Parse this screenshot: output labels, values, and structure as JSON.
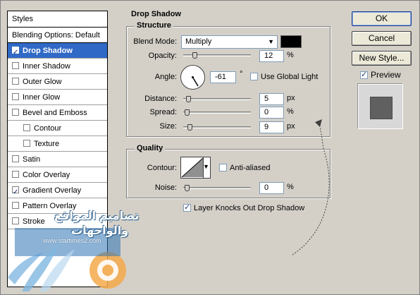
{
  "styles_panel": {
    "header": "Styles",
    "items": [
      {
        "label": "Blending Options: Default",
        "has_checkbox": false,
        "checked": false,
        "selected": false,
        "sub": false
      },
      {
        "label": "Drop Shadow",
        "has_checkbox": true,
        "checked": true,
        "selected": true,
        "sub": false
      },
      {
        "label": "Inner Shadow",
        "has_checkbox": true,
        "checked": false,
        "selected": false,
        "sub": false
      },
      {
        "label": "Outer Glow",
        "has_checkbox": true,
        "checked": false,
        "selected": false,
        "sub": false
      },
      {
        "label": "Inner Glow",
        "has_checkbox": true,
        "checked": false,
        "selected": false,
        "sub": false
      },
      {
        "label": "Bevel and Emboss",
        "has_checkbox": true,
        "checked": false,
        "selected": false,
        "sub": false
      },
      {
        "label": "Contour",
        "has_checkbox": true,
        "checked": false,
        "selected": false,
        "sub": true
      },
      {
        "label": "Texture",
        "has_checkbox": true,
        "checked": false,
        "selected": false,
        "sub": true
      },
      {
        "label": "Satin",
        "has_checkbox": true,
        "checked": false,
        "selected": false,
        "sub": false
      },
      {
        "label": "Color Overlay",
        "has_checkbox": true,
        "checked": false,
        "selected": false,
        "sub": false
      },
      {
        "label": "Gradient Overlay",
        "has_checkbox": true,
        "checked": true,
        "selected": false,
        "sub": false
      },
      {
        "label": "Pattern Overlay",
        "has_checkbox": true,
        "checked": false,
        "selected": false,
        "sub": false
      },
      {
        "label": "Stroke",
        "has_checkbox": true,
        "checked": false,
        "selected": false,
        "sub": false
      }
    ]
  },
  "drop_shadow": {
    "title": "Drop Shadow",
    "structure": {
      "title": "Structure",
      "blend_mode_label": "Blend Mode:",
      "blend_mode_value": "Multiply",
      "shadow_color": "#000000",
      "opacity_label": "Opacity:",
      "opacity_value": "12",
      "opacity_unit": "%",
      "opacity_level": 0.12,
      "angle_label": "Angle:",
      "angle_value": "-61",
      "angle_unit": "°",
      "use_global_light_label": "Use Global Light",
      "use_global_light_checked": false,
      "distance_label": "Distance:",
      "distance_value": "5",
      "distance_unit": "px",
      "distance_level": 0.02,
      "spread_label": "Spread:",
      "spread_value": "0",
      "spread_unit": "%",
      "spread_level": 0.0,
      "size_label": "Size:",
      "size_value": "9",
      "size_unit": "px",
      "size_level": 0.04
    },
    "quality": {
      "title": "Quality",
      "contour_label": "Contour:",
      "anti_aliased_label": "Anti-aliased",
      "anti_aliased_checked": false,
      "noise_label": "Noise:",
      "noise_value": "0",
      "noise_unit": "%",
      "noise_level": 0.0
    },
    "layer_knocks_out_label": "Layer Knocks Out Drop Shadow",
    "layer_knocks_out_checked": true
  },
  "buttons": {
    "ok": "OK",
    "cancel": "Cancel",
    "new_style": "New Style..."
  },
  "preview": {
    "label": "Preview",
    "checked": true
  },
  "watermark": {
    "line1": "تصاميم المواقع",
    "line2": "والواجهات",
    "url": "www.startimes2.com"
  }
}
